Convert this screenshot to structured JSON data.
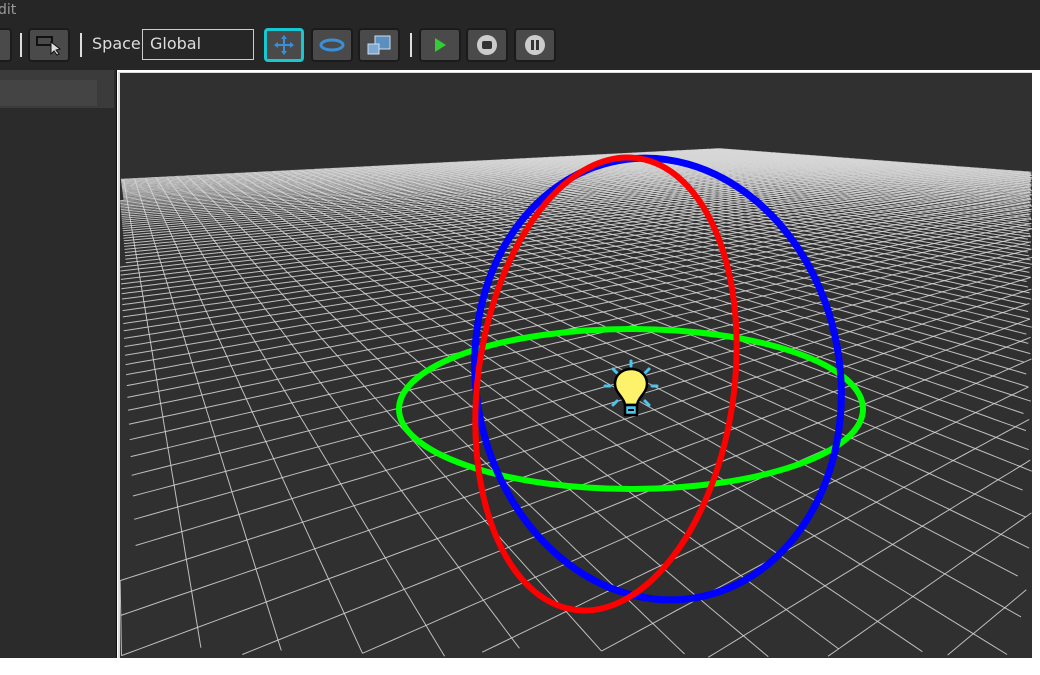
{
  "menu": {
    "edit_label": "dit"
  },
  "toolbar": {
    "space_label": "Space",
    "space_value": "Global"
  },
  "colors": {
    "x_axis": "#ff0000",
    "y_axis": "#00ff00",
    "z_axis": "#0000ff",
    "active": "#18c8d0",
    "bulb": "#fdf26a"
  }
}
